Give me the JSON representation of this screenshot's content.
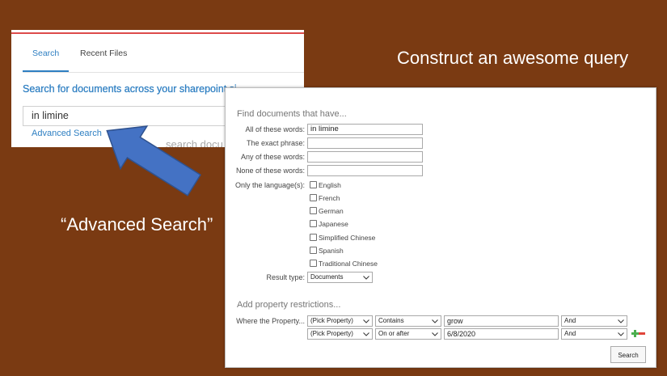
{
  "slide": {
    "title": "Construct an awesome query",
    "caption": "“Advanced Search”"
  },
  "search_panel": {
    "tabs": [
      {
        "label": "Search",
        "active": true
      },
      {
        "label": "Recent Files",
        "active": false
      }
    ],
    "heading": "Search for documents across your sharepoint si",
    "query": "in limine",
    "advanced_link": "Advanced Search",
    "suggestion": "search docu"
  },
  "advanced_search": {
    "heading": "Find documents that have...",
    "fields": [
      {
        "label": "All of these words:",
        "value": "in limine"
      },
      {
        "label": "The exact phrase:",
        "value": ""
      },
      {
        "label": "Any of these words:",
        "value": ""
      },
      {
        "label": "None of these words:",
        "value": ""
      }
    ],
    "languages_label": "Only the language(s):",
    "languages": [
      {
        "name": "English",
        "checked": false
      },
      {
        "name": "French",
        "checked": false
      },
      {
        "name": "German",
        "checked": false
      },
      {
        "name": "Japanese",
        "checked": false
      },
      {
        "name": "Simplified Chinese",
        "checked": false
      },
      {
        "name": "Spanish",
        "checked": false
      },
      {
        "name": "Traditional Chinese",
        "checked": false
      }
    ],
    "result_type": {
      "label": "Result type:",
      "value": "Documents"
    },
    "property_heading": "Add property restrictions...",
    "property_label": "Where the Property...",
    "restrictions": [
      {
        "property": "(Pick Property)",
        "operator": "Contains",
        "value": "grow",
        "conjunction": "And"
      },
      {
        "property": "(Pick Property)",
        "operator": "On or after",
        "value": "6/8/2020",
        "conjunction": "And"
      }
    ],
    "search_button": "Search"
  },
  "icons": {
    "pointer": "arrow-icon",
    "dropdown": "chevron-down-icon",
    "add_row": "plus-icon",
    "remove_row": "minus-icon"
  },
  "colors": {
    "slide_background": "#7A3A12",
    "slide_text": "#FFFFFF",
    "accent_blue": "#2E7FC2",
    "top_bar_red": "#DD4B4B",
    "arrow_fill": "#4472C4",
    "arrow_stroke": "#2F528F",
    "add_green": "#4CAF50",
    "remove_red": "#E0453A"
  }
}
